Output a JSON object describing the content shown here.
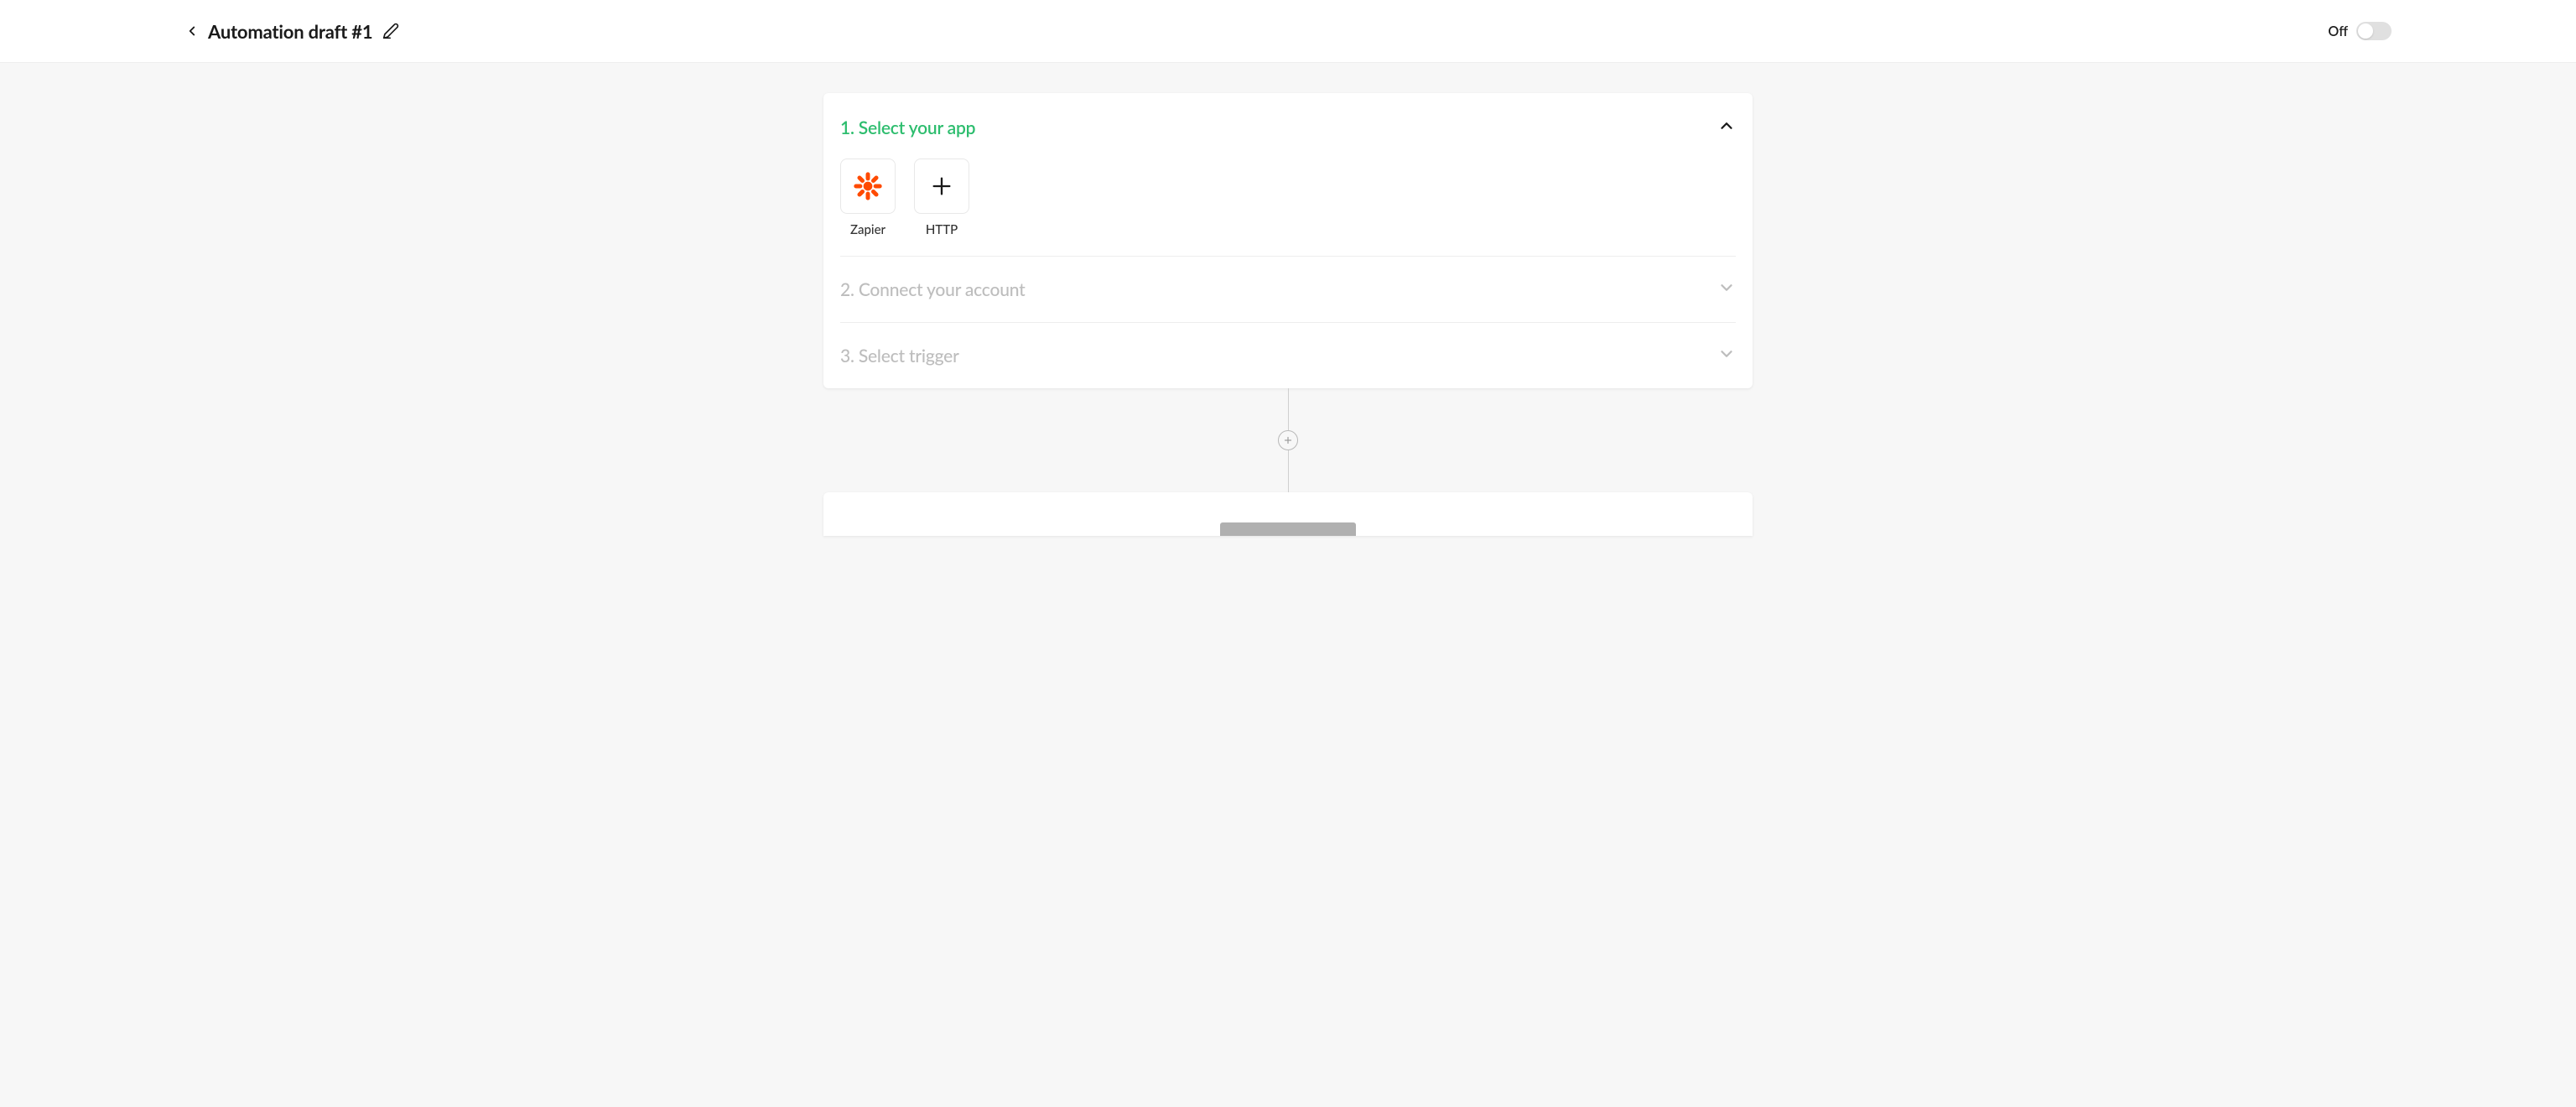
{
  "header": {
    "title": "Automation draft #1",
    "toggle_label": "Off",
    "toggle_on": false
  },
  "card": {
    "sections": [
      {
        "title": "1. Select your app",
        "active": true,
        "expanded": true,
        "apps": [
          {
            "label": "Zapier",
            "icon": "zapier-icon"
          },
          {
            "label": "HTTP",
            "icon": "plus-icon"
          }
        ]
      },
      {
        "title": "2. Connect your account",
        "active": false,
        "expanded": false
      },
      {
        "title": "3. Select trigger",
        "active": false,
        "expanded": false
      }
    ]
  }
}
